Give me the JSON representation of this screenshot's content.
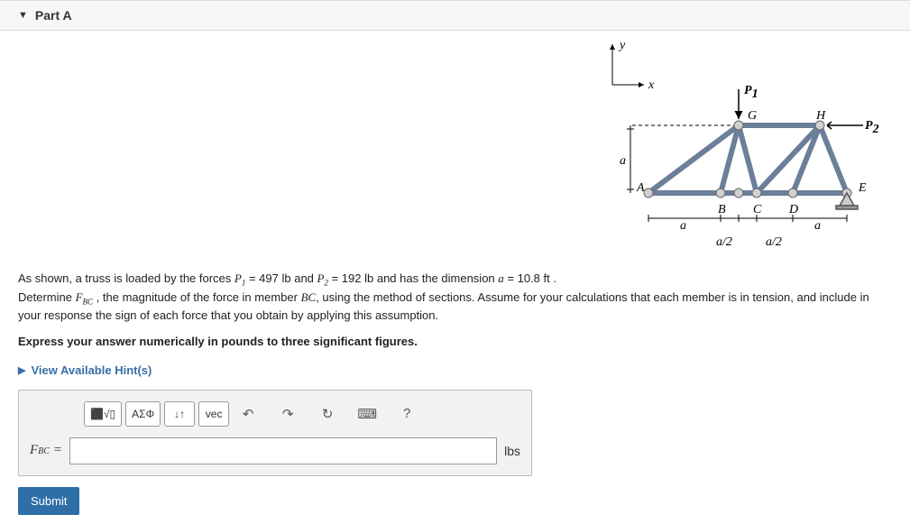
{
  "part": {
    "label": "Part A"
  },
  "figure": {
    "axis_y": "y",
    "axis_x": "x",
    "P1": "P",
    "P1sub": "1",
    "P2": "P",
    "P2sub": "2",
    "a_vert": "a",
    "A": "A",
    "B": "B",
    "C": "C",
    "D": "D",
    "E": "E",
    "G": "G",
    "H": "H",
    "a_left": "a",
    "a_right": "a",
    "a2_left": "a/2",
    "a2_right": "a/2"
  },
  "problem": {
    "line1a": "As shown, a truss is loaded by the forces ",
    "P1var": "P",
    "P1sub": "1",
    "P1val": " = 497 ",
    "lb1": "lb",
    "and1": " and ",
    "P2var": "P",
    "P2sub": "2",
    "P2val": " = 192 ",
    "lb2": "lb",
    "hasdim": " and has the dimension ",
    "avar": "a",
    "aval": " = 10.8 ",
    "ft": "ft",
    "period1": " .",
    "det": "Determine   ",
    "Fvar": "F",
    "Fsub": "BC",
    "line2b": " , the magnitude of the force in member ",
    "BC": "BC",
    "line2c": ", using the method of sections. Assume for your calculations that each member is in tension, and include in your response the sign of each force that you obtain by applying this assumption.",
    "bold": "Express your answer numerically in pounds to three significant figures."
  },
  "hints": {
    "label": "View Available Hint(s)"
  },
  "toolbar": {
    "templates": "⬛√▯",
    "greek": "ΑΣΦ",
    "subsuper": "↓↑",
    "vec": "vec",
    "undo": "↶",
    "redo": "↷",
    "reset": "↻",
    "keyboard": "⌨",
    "help": "?"
  },
  "answer": {
    "lhs_F": "F",
    "lhs_sub": "BC",
    "equals": " = ",
    "value": "",
    "unit": "lbs"
  },
  "submit": {
    "label": "Submit"
  }
}
